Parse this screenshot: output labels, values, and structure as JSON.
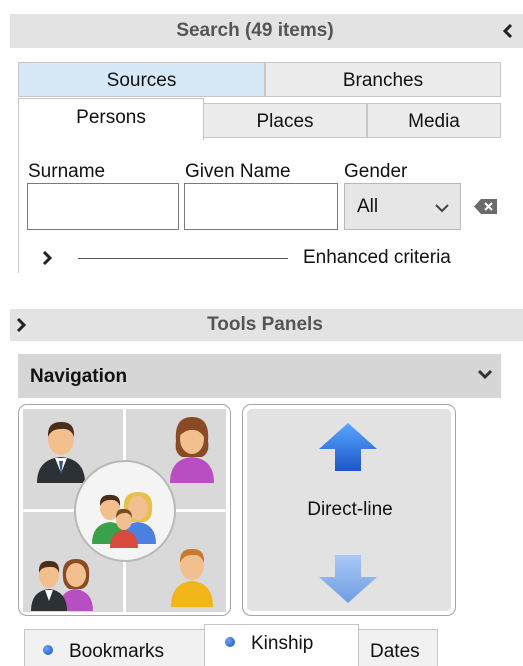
{
  "search": {
    "title": "Search (49 items)",
    "collapse_icon": "chevron-left-icon",
    "tabs_row1": [
      "Sources",
      "Branches"
    ],
    "tabs_row2": [
      "Persons",
      "Places",
      "Media"
    ],
    "active_tab": "Persons",
    "fields": {
      "surname_label": "Surname",
      "surname_value": "",
      "given_label": "Given Name",
      "given_value": "",
      "gender_label": "Gender",
      "gender_value": "All"
    },
    "enhanced_label": "Enhanced criteria"
  },
  "tools": {
    "title": "Tools Panels",
    "expand_icon": "chevron-right-icon"
  },
  "navigation": {
    "title": "Navigation",
    "direct_line_label": "Direct-line",
    "bottom_tabs": [
      "Bookmarks",
      "Kinship",
      "Dates"
    ],
    "active_bottom_tab": "Kinship"
  },
  "colors": {
    "header_bg": "#e3e3e3",
    "active_tab_blue": "#d7e8f6",
    "arrow_blue": "#2f7de1"
  }
}
